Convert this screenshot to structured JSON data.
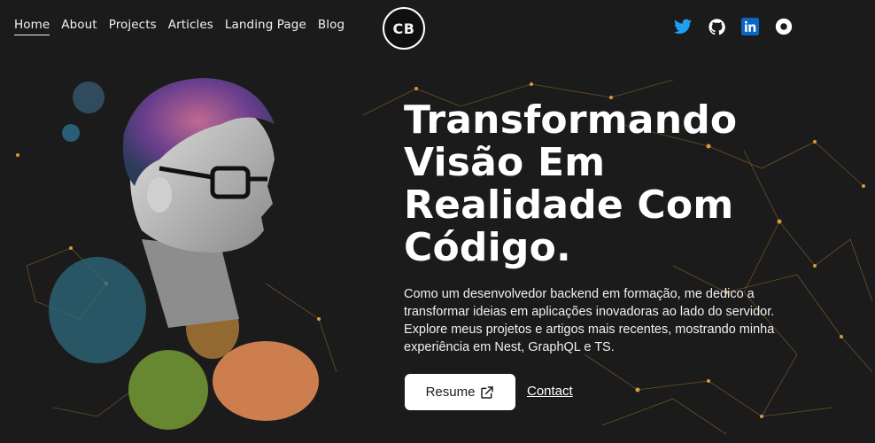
{
  "nav": {
    "items": [
      {
        "label": "Home",
        "active": true
      },
      {
        "label": "About"
      },
      {
        "label": "Projects"
      },
      {
        "label": "Articles"
      },
      {
        "label": "Landing Page"
      },
      {
        "label": "Blog"
      }
    ]
  },
  "logo": {
    "text": "CB"
  },
  "socials": [
    {
      "icon": "twitter-icon",
      "color": "#1da1f2"
    },
    {
      "icon": "github-icon",
      "color": "#ffffff"
    },
    {
      "icon": "linkedin-icon",
      "color": "#0a66c2"
    },
    {
      "icon": "dribbble-icon",
      "color": "#ffffff"
    }
  ],
  "hero": {
    "headline": "Transformando Visão Em Realidade Com Código.",
    "description": "Como um desenvolvedor backend em formação, me dedico a transformar ideias em aplicações inovadoras ao lado do servidor. Explore meus projetos e artigos mais recentes, mostrando minha experiência em Nest, GraphQL e TS.",
    "resume_label": "Resume",
    "contact_label": "Contact"
  },
  "colors": {
    "background": "#1b1b1b",
    "accent_network": "#d79a3c"
  }
}
